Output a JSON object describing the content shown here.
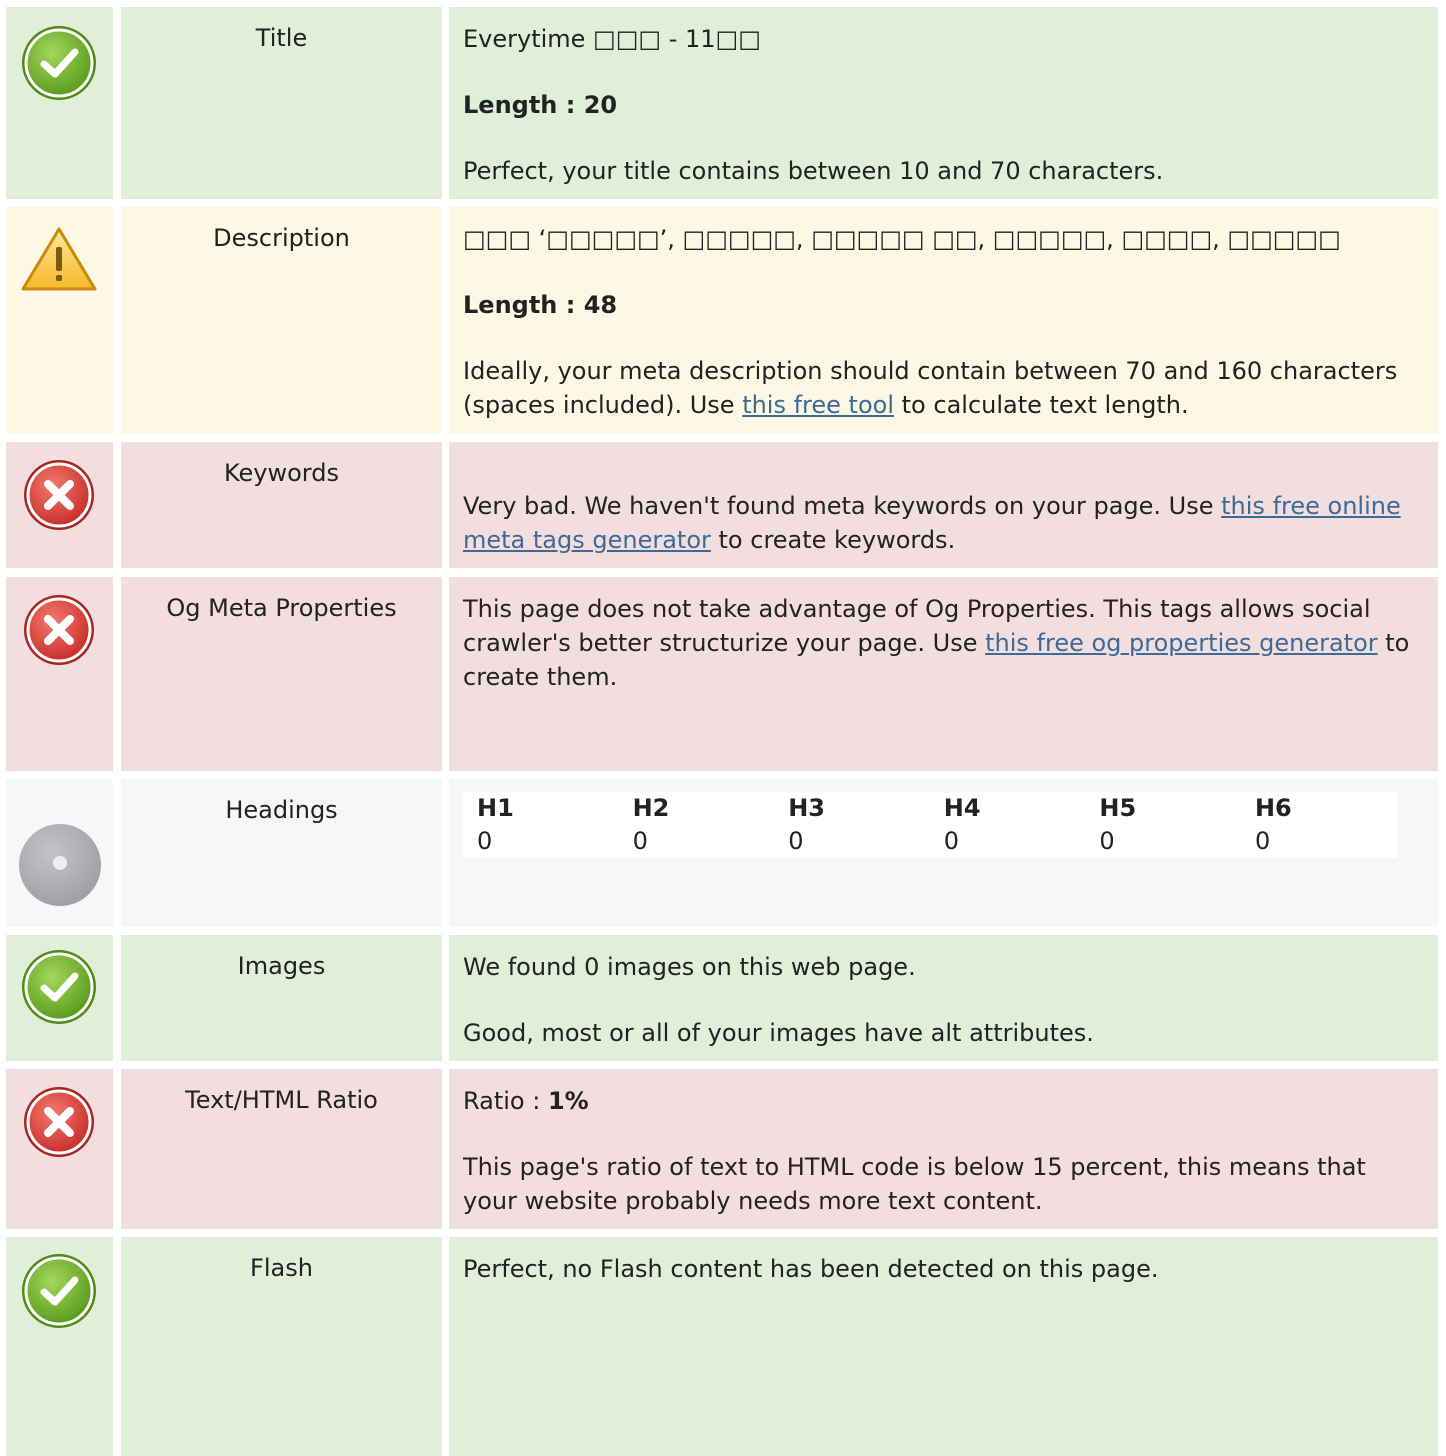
{
  "rows": {
    "title": {
      "label": "Title",
      "status": "pass",
      "value": "Everytime \u0000\u0000\u0000 - 11\u0000\u0000",
      "value_display": "Everytime □□□ - 11□□",
      "length_label": "Length : 20",
      "message": "Perfect, your title contains between 10 and 70 characters."
    },
    "description": {
      "label": "Description",
      "status": "warning",
      "value_display": "□□□ ‘□□□□□’, □□□□□, □□□□□ □□, □□□□□, □□□□, □□□□□",
      "length_label": "Length : 48",
      "message_pre": "Ideally, your meta description should contain between 70 and 160 characters (spaces included). Use ",
      "link": "this free tool",
      "message_post": " to calculate text length."
    },
    "keywords": {
      "label": "Keywords",
      "status": "fail",
      "message_pre": "Very bad. We haven't found meta keywords on your page. Use ",
      "link": "this free online meta tags generator",
      "message_post": " to create keywords."
    },
    "og": {
      "label": "Og Meta Properties",
      "status": "fail",
      "message_pre": "This page does not take advantage of Og Properties. This tags allows social crawler's better structurize your page. Use ",
      "link": "this free og properties generator",
      "message_post": " to create them."
    },
    "headings": {
      "label": "Headings",
      "status": "info",
      "columns": [
        {
          "tag": "H1",
          "count": "0"
        },
        {
          "tag": "H2",
          "count": "0"
        },
        {
          "tag": "H3",
          "count": "0"
        },
        {
          "tag": "H4",
          "count": "0"
        },
        {
          "tag": "H5",
          "count": "0"
        },
        {
          "tag": "H6",
          "count": "0"
        }
      ]
    },
    "images": {
      "label": "Images",
      "status": "pass",
      "found": "We found 0 images on this web page.",
      "message": "Good, most or all of your images have alt attributes."
    },
    "ratio": {
      "label": "Text/HTML Ratio",
      "status": "fail",
      "ratio_label": "Ratio : ",
      "ratio_value": "1%",
      "message": "This page's ratio of text to HTML code is below 15 percent, this means that your website probably needs more text content."
    },
    "flash": {
      "label": "Flash",
      "status": "pass",
      "message": "Perfect, no Flash content has been detected on this page."
    }
  },
  "colors": {
    "pass_bg": "#dfefd8",
    "warning_bg": "#fcf8e4",
    "fail_bg": "#f2dede",
    "info_bg": "#f7f7f7",
    "link": "#3d6a96"
  },
  "icons": {
    "pass": "check-circle-icon",
    "warning": "warning-triangle-icon",
    "fail": "x-circle-icon",
    "info": "grey-circle-icon"
  }
}
